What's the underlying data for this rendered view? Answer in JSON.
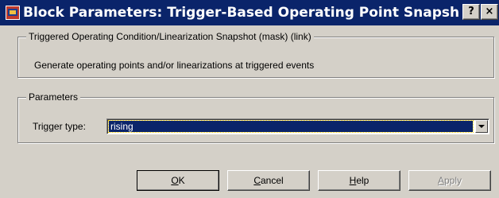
{
  "window": {
    "title": "Block Parameters: Trigger-Based  Operating Point Snapsh...",
    "help_glyph": "?",
    "close_glyph": "×",
    "icon": "simulink-block-icon"
  },
  "mask_group": {
    "legend": "Triggered Operating Condition/Linearization Snapshot (mask) (link)",
    "description": "Generate operating points and/or linearizations at triggered events"
  },
  "parameters_group": {
    "legend": "Parameters",
    "trigger_label": "Trigger type:",
    "trigger_value": "rising"
  },
  "buttons": {
    "ok": {
      "mnemonic": "O",
      "rest": "K"
    },
    "cancel": {
      "mnemonic": "C",
      "rest": "ancel"
    },
    "help": {
      "mnemonic": "H",
      "rest": "elp"
    },
    "apply": {
      "mnemonic": "A",
      "rest": "pply"
    }
  },
  "colors": {
    "titlebar": "#0a246a",
    "face": "#d4d0c8",
    "selection": "#0a246a"
  }
}
